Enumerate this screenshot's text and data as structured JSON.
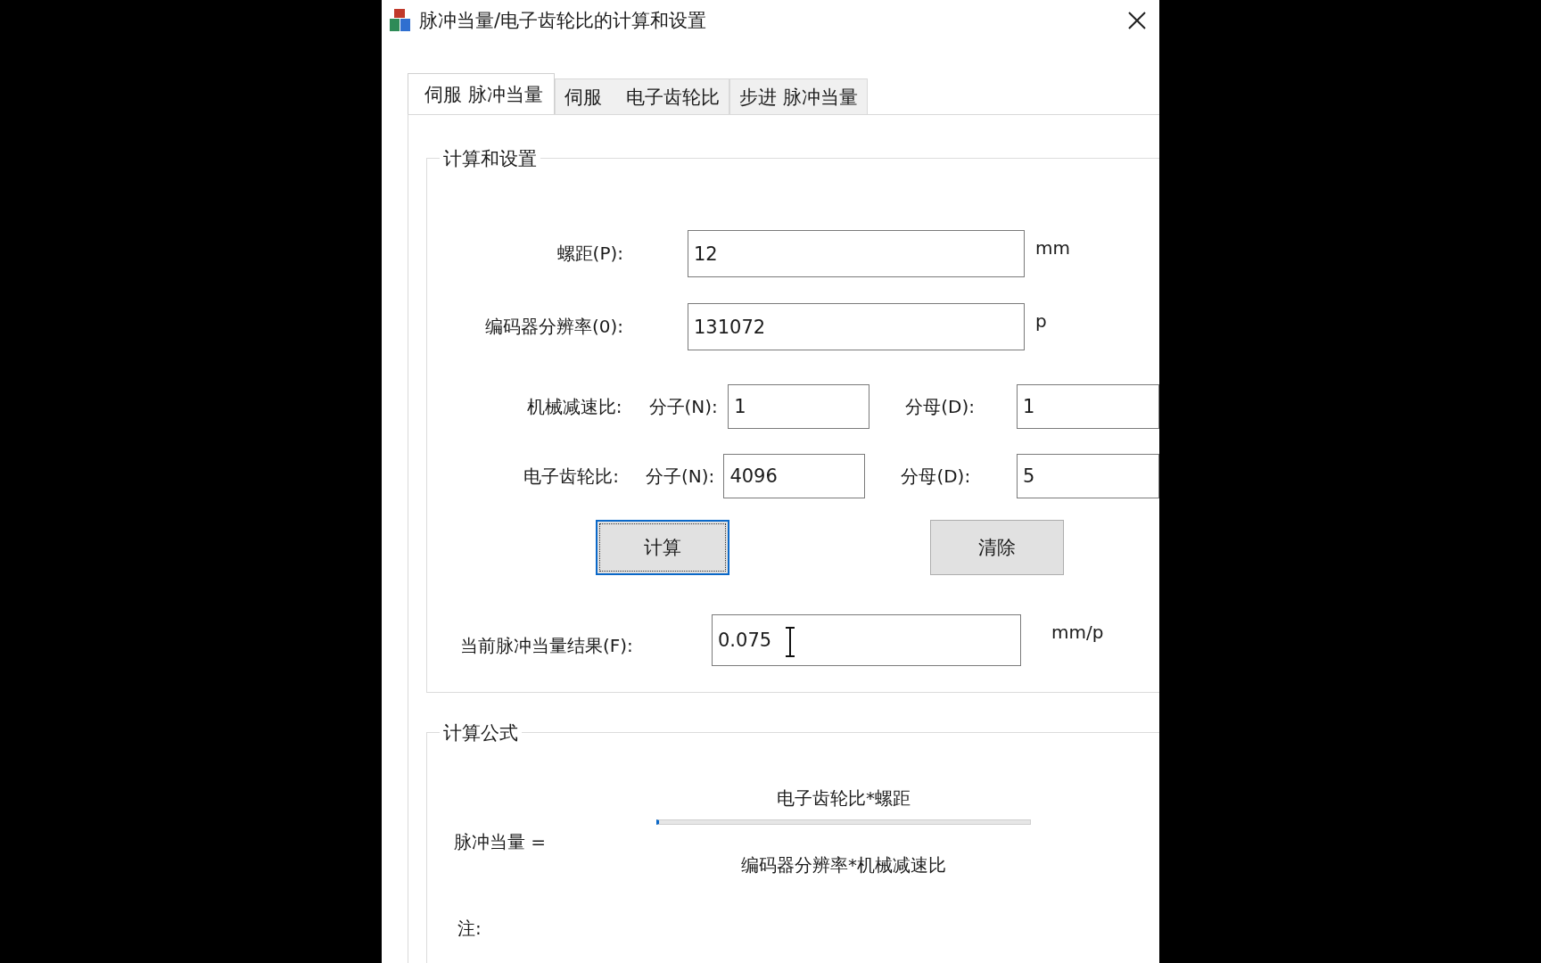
{
  "window": {
    "title": "脉冲当量/电子齿轮比的计算和设置"
  },
  "tabs": [
    {
      "label": "伺服 脉冲当量",
      "selected": true
    },
    {
      "label": "伺服　 电子齿轮比",
      "selected": false
    },
    {
      "label": "步进 脉冲当量",
      "selected": false
    }
  ],
  "settings": {
    "title": "计算和设置",
    "pitch": {
      "label": "螺距(P):",
      "value": "12",
      "unit": "mm"
    },
    "encoder": {
      "label": "编码器分辨率(0):",
      "value": "131072",
      "unit": "p"
    },
    "ratios": [
      {
        "label": "机械减速比:",
        "numerator_label": "分子(N):",
        "numerator": "1",
        "denominator_label": "分母(D):",
        "denominator": "1"
      },
      {
        "label": "电子齿轮比:",
        "numerator_label": "分子(N):",
        "numerator": "4096",
        "denominator_label": "分母(D):",
        "denominator": "5"
      }
    ],
    "buttons": [
      {
        "label": "计算",
        "focused": true
      },
      {
        "label": "清除",
        "focused": false
      }
    ],
    "result": {
      "label": "当前脉冲当量结果(F):",
      "value": "0.075",
      "unit": "mm/p"
    }
  },
  "formula": {
    "title": "计算公式",
    "lhs": "脉冲当量 =",
    "numerator": "电子齿轮比*螺距",
    "denominator": "编码器分辨率*机械减速比",
    "note": "注:"
  }
}
